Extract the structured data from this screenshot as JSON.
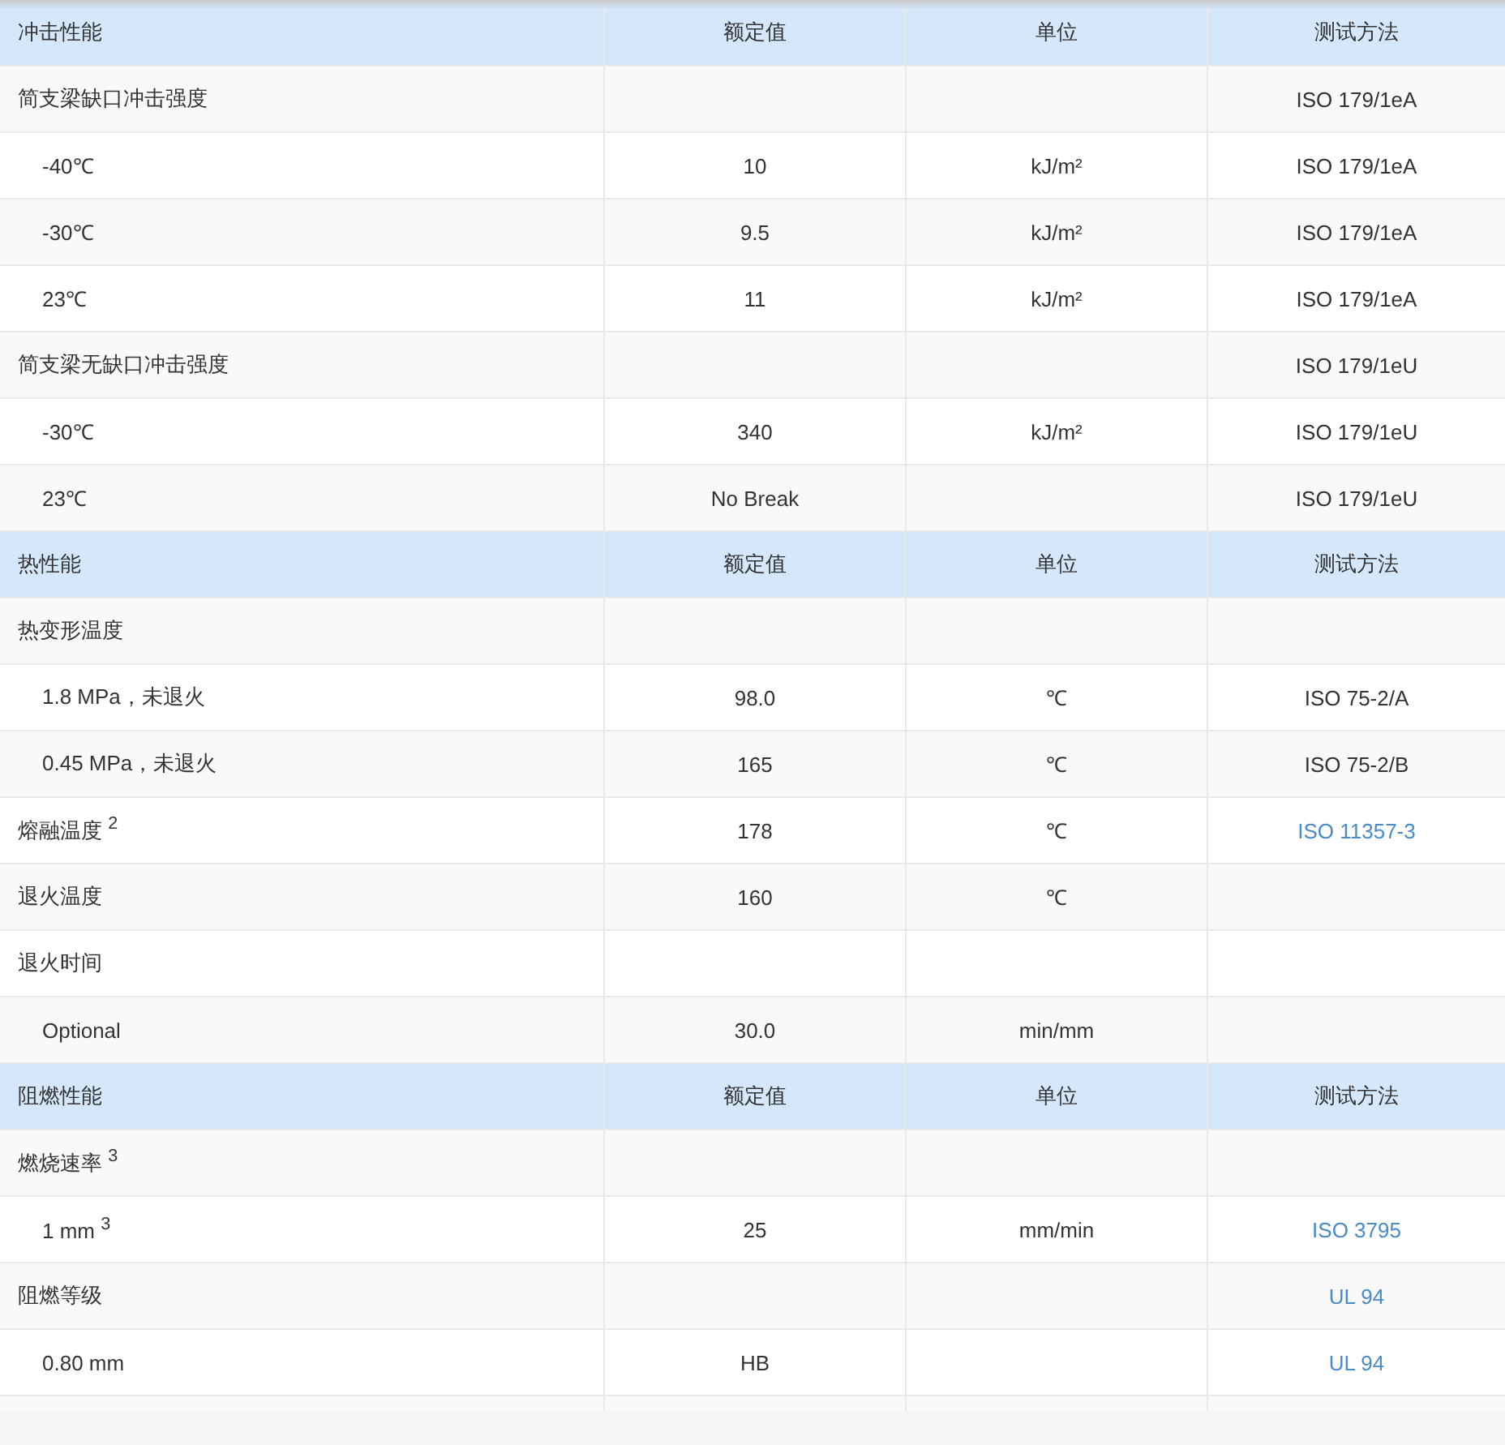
{
  "sections": [
    {
      "header": {
        "property": "冲击性能",
        "value": "额定值",
        "unit": "单位",
        "method": "测试方法"
      },
      "rows": [
        {
          "kind": "group",
          "property": "简支梁缺口冲击强度",
          "method": "ISO 179/1eA",
          "link": false
        },
        {
          "kind": "item",
          "property": "-40℃",
          "value": "10",
          "unit": "kJ/m²",
          "method": "ISO 179/1eA",
          "link": false
        },
        {
          "kind": "item",
          "property": "-30℃",
          "value": "9.5",
          "unit": "kJ/m²",
          "method": "ISO 179/1eA",
          "link": false
        },
        {
          "kind": "item",
          "property": "23℃",
          "value": "11",
          "unit": "kJ/m²",
          "method": "ISO 179/1eA",
          "link": false
        },
        {
          "kind": "group",
          "property": "简支梁无缺口冲击强度",
          "method": "ISO 179/1eU",
          "link": false
        },
        {
          "kind": "item",
          "property": "-30℃",
          "value": "340",
          "unit": "kJ/m²",
          "method": "ISO 179/1eU",
          "link": false
        },
        {
          "kind": "item",
          "property": "23℃",
          "value": "No Break",
          "method": "ISO 179/1eU",
          "link": false
        }
      ]
    },
    {
      "header": {
        "property": "热性能",
        "value": "额定值",
        "unit": "单位",
        "method": "测试方法"
      },
      "rows": [
        {
          "kind": "group",
          "property": "热变形温度"
        },
        {
          "kind": "item",
          "property": "1.8 MPa，未退火",
          "value": "98.0",
          "unit": "℃",
          "method": "ISO 75-2/A",
          "link": false
        },
        {
          "kind": "item",
          "property": "0.45 MPa，未退火",
          "value": "165",
          "unit": "℃",
          "method": "ISO 75-2/B",
          "link": false
        },
        {
          "kind": "group",
          "property": "熔融温度 $^{2}$",
          "value": "178",
          "unit": "℃",
          "method": "ISO 11357-3",
          "link": true
        },
        {
          "kind": "group",
          "property": "退火温度",
          "value": "160",
          "unit": "℃"
        },
        {
          "kind": "group",
          "property": "退火时间"
        },
        {
          "kind": "item",
          "property": "Optional",
          "value": "30.0",
          "unit": "min/mm"
        }
      ]
    },
    {
      "header": {
        "property": "阻燃性能",
        "value": "额定值",
        "unit": "单位",
        "method": "测试方法"
      },
      "rows": [
        {
          "kind": "group",
          "property": "燃烧速率 $^{3}$"
        },
        {
          "kind": "item",
          "property": "1 mm $^{3}$",
          "value": "25",
          "unit": "mm/min",
          "method": "ISO 3795",
          "link": true
        },
        {
          "kind": "group",
          "property": "阻燃等级",
          "method": "UL 94",
          "link": true
        },
        {
          "kind": "item",
          "property": "0.80 mm",
          "value": "HB",
          "method": "UL 94",
          "link": true
        }
      ]
    }
  ]
}
